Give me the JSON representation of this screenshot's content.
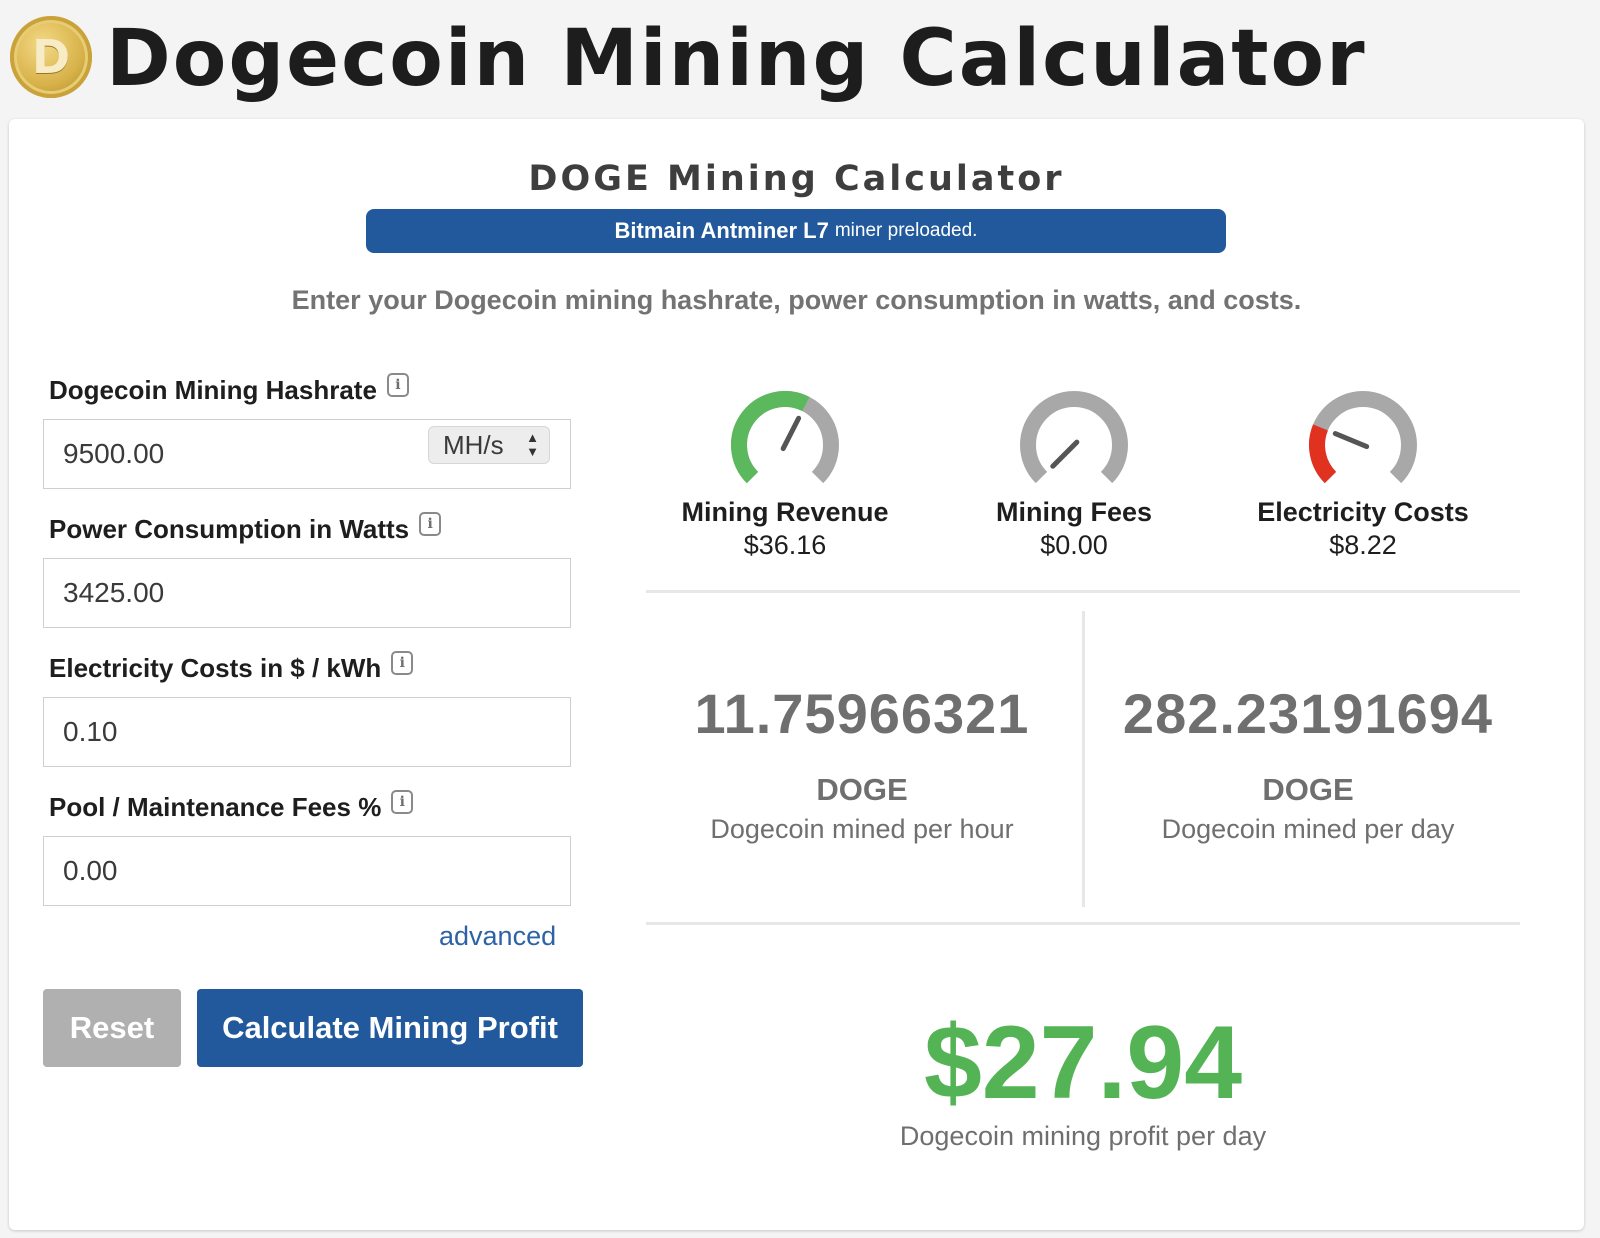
{
  "header": {
    "title": "Dogecoin Mining Calculator",
    "logo_glyph": "D"
  },
  "calculator": {
    "title": "DOGE Mining Calculator",
    "banner": {
      "miner": "Bitmain Antminer L7",
      "note": "miner preloaded."
    },
    "instructions": "Enter your Dogecoin mining hashrate, power consumption in watts, and costs."
  },
  "form": {
    "hashrate": {
      "label": "Dogecoin Mining Hashrate",
      "value": "9500.00",
      "unit": "MH/s"
    },
    "power": {
      "label": "Power Consumption in Watts",
      "value": "3425.00"
    },
    "electricity": {
      "label": "Electricity Costs in $ / kWh",
      "value": "0.10"
    },
    "fees": {
      "label": "Pool / Maintenance Fees %",
      "value": "0.00"
    },
    "info_icon": "i",
    "advanced_link": "advanced",
    "reset_button": "Reset",
    "calculate_button": "Calculate Mining Profit"
  },
  "gauges": [
    {
      "label": "Mining Revenue",
      "value": "$36.16",
      "level": 0.6,
      "fill_color": "#5cb85c"
    },
    {
      "label": "Mining Fees",
      "value": "$0.00",
      "level": 0.0,
      "fill_color": "#5cb85c"
    },
    {
      "label": "Electricity Costs",
      "value": "$8.22",
      "level": 0.25,
      "fill_color": "#e0321f"
    }
  ],
  "stats": {
    "hourly": {
      "amount": "11.75966321",
      "unit": "DOGE",
      "description": "Dogecoin mined per hour"
    },
    "daily": {
      "amount": "282.23191694",
      "unit": "DOGE",
      "description": "Dogecoin mined per day"
    }
  },
  "profit": {
    "amount": "$27.94",
    "description": "Dogecoin mining profit per day"
  },
  "colors": {
    "brand_blue": "#21599c",
    "profit_green": "#54b455",
    "gauge_track": "#a8a8a8"
  }
}
